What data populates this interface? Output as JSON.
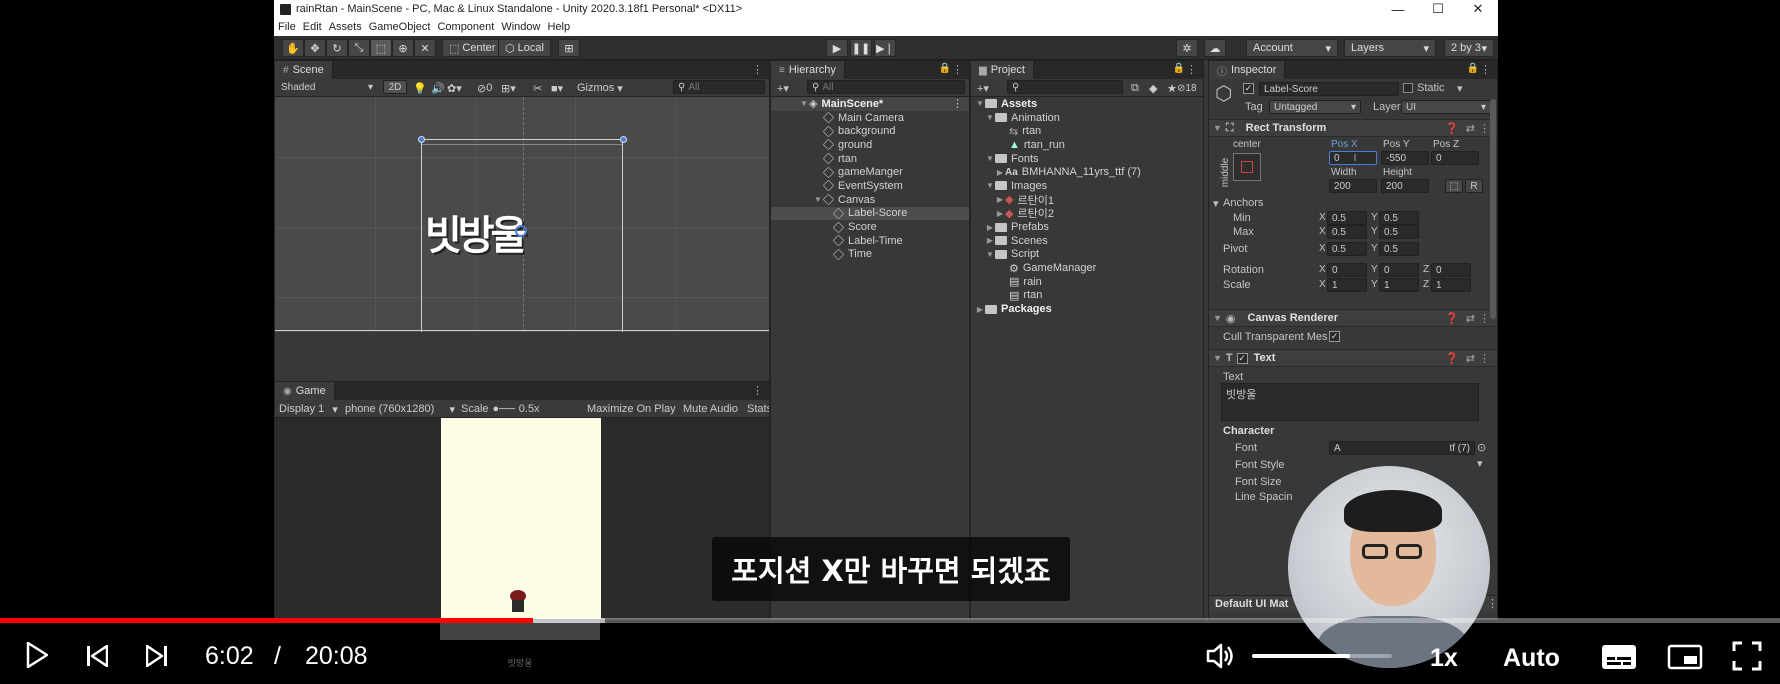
{
  "window": {
    "title": "rainRtan - MainScene - PC, Mac & Linux Standalone - Unity 2020.3.18f1 Personal* <DX11>",
    "menu": [
      "File",
      "Edit",
      "Assets",
      "GameObject",
      "Component",
      "Window",
      "Help"
    ]
  },
  "toolbar": {
    "pivot_label": "Center",
    "space_label": "Local",
    "account_label": "Account",
    "layers_label": "Layers",
    "layout_label": "2 by 3"
  },
  "scene": {
    "tab_label": "Scene",
    "shading_mode": "Shaded",
    "mode_2d": "2D",
    "hidden_count": "0",
    "gizmos_label": "Gizmos",
    "search_placeholder": "All",
    "canvas_text": "빗방울"
  },
  "game": {
    "tab_label": "Game",
    "display": "Display 1",
    "resolution": "phone (760x1280)",
    "scale_label": "Scale",
    "scale_value": "0.5x",
    "maximize_label": "Maximize On Play",
    "mute_label": "Mute Audio",
    "stats_label": "Stats",
    "phone_label": "빗방울"
  },
  "hierarchy": {
    "tab_label": "Hierarchy",
    "search_placeholder": "All",
    "scene_name": "MainScene*",
    "items": [
      "Main Camera",
      "background",
      "ground",
      "rtan",
      "gameManger",
      "EventSystem",
      "Canvas"
    ],
    "canvas_children": [
      "Label-Score",
      "Score",
      "Label-Time",
      "Time"
    ]
  },
  "project": {
    "tab_label": "Project",
    "hidden_count": "18",
    "assets_label": "Assets",
    "animation_label": "Animation",
    "animation_items": [
      "rtan",
      "rtan_run"
    ],
    "fonts_label": "Fonts",
    "font_item": "BMHANNA_11yrs_ttf (7)",
    "images_label": "Images",
    "image_items": [
      "르탄이1",
      "르탄이2"
    ],
    "prefabs_label": "Prefabs",
    "scenes_label": "Scenes",
    "script_label": "Script",
    "script_items": [
      "GameManager",
      "rain",
      "rtan"
    ],
    "packages_label": "Packages"
  },
  "inspector": {
    "tab_label": "Inspector",
    "object_name": "Label-Score",
    "static_label": "Static",
    "tag_label": "Tag",
    "tag_value": "Untagged",
    "layer_label": "Layer",
    "layer_value": "UI",
    "rect_transform": {
      "title": "Rect Transform",
      "anchor_h": "center",
      "anchor_v": "middle",
      "pos_x_label": "Pos X",
      "pos_x": "0",
      "pos_y_label": "Pos Y",
      "pos_y": "-550",
      "pos_z_label": "Pos Z",
      "pos_z": "0",
      "width_label": "Width",
      "width": "200",
      "height_label": "Height",
      "height": "200",
      "raw_label": "R",
      "anchors_label": "Anchors",
      "min_label": "Min",
      "min_x": "0.5",
      "min_y": "0.5",
      "max_label": "Max",
      "max_x": "0.5",
      "max_y": "0.5",
      "pivot_label": "Pivot",
      "pivot_x": "0.5",
      "pivot_y": "0.5",
      "rotation_label": "Rotation",
      "rot_x": "0",
      "rot_y": "0",
      "rot_z": "0",
      "scale_label": "Scale",
      "scale_x": "1",
      "scale_y": "1",
      "scale_z": "1",
      "axis_x": "X",
      "axis_y": "Y",
      "axis_z": "Z"
    },
    "canvas_renderer": {
      "title": "Canvas Renderer",
      "cull_label": "Cull Transparent Mes"
    },
    "text": {
      "title": "Text",
      "text_label": "Text",
      "text_value": "빗방울",
      "character_label": "Character",
      "font_label": "Font",
      "font_value_start": "A",
      "font_value_end": "tf (7)",
      "font_style_label": "Font Style",
      "font_size_label": "Font Size",
      "line_spacing_label": "Line Spacin"
    },
    "material_label": "Default UI Mat"
  },
  "player": {
    "current_time": "6:02",
    "separator": "/",
    "duration": "20:08",
    "progress": 0.2997,
    "buffered": 0.34,
    "volume": 0.7,
    "speed_label": "1x",
    "quality_label": "Auto",
    "subtitle": "포지션 X만 바꾸면 되겠죠"
  },
  "colors": {
    "progress": "#ff0000",
    "selection": "#4d4d4d",
    "accent_blue": "#4a7fd4"
  }
}
